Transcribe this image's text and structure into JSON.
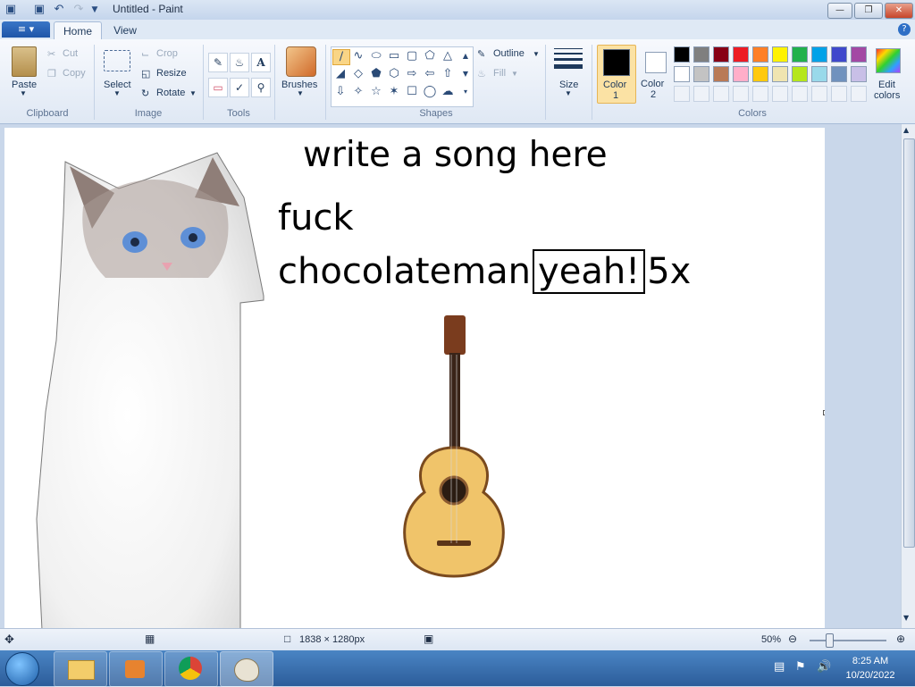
{
  "window": {
    "title": "Untitled - Paint",
    "controls": [
      "minimize",
      "restore",
      "close"
    ]
  },
  "tabs": {
    "file_menu": "≡ ▾",
    "home": "Home",
    "view": "View"
  },
  "clipboard": {
    "label": "Clipboard",
    "paste": "Paste",
    "cut": "Cut",
    "copy": "Copy"
  },
  "image_group": {
    "label": "Image",
    "select": "Select",
    "crop": "Crop",
    "resize": "Resize",
    "rotate": "Rotate"
  },
  "tools_group": {
    "label": "Tools",
    "items": [
      "pencil-icon",
      "fill-icon",
      "text-icon",
      "eraser-icon",
      "color-picker-icon",
      "magnifier-icon"
    ]
  },
  "brushes": {
    "label": "Brushes"
  },
  "shapes_group": {
    "label": "Shapes",
    "outline": "Outline",
    "fill": "Fill"
  },
  "size_group": {
    "label": "Size"
  },
  "colors_group": {
    "label": "Colors",
    "color1_line1": "Color",
    "color1_line2": "1",
    "color2_line1": "Color",
    "color2_line2": "2",
    "edit_line1": "Edit",
    "edit_line2": "colors",
    "color1": "#000000",
    "color2": "#ffffff",
    "palette_row1": [
      "#000000",
      "#7f7f7f",
      "#880015",
      "#ed1c24",
      "#ff7f27",
      "#fff200",
      "#22b14c",
      "#00a2e8",
      "#3f48cc",
      "#a349a4"
    ],
    "palette_row2": [
      "#ffffff",
      "#c3c3c3",
      "#b97a57",
      "#ffaec9",
      "#ffc90e",
      "#efe4b0",
      "#b5e61d",
      "#99d9ea",
      "#7092be",
      "#c8bfe7"
    ]
  },
  "canvas": {
    "heading": "write a song here",
    "line1": "fuck",
    "line2_start": "chocolateman",
    "line2_boxed": "yeah!",
    "line2_end": "5x"
  },
  "statusbar": {
    "dimensions": "1838 × 1280px",
    "zoom": "50%"
  },
  "clock": {
    "time": "8:25 AM",
    "date": "10/20/2022"
  }
}
